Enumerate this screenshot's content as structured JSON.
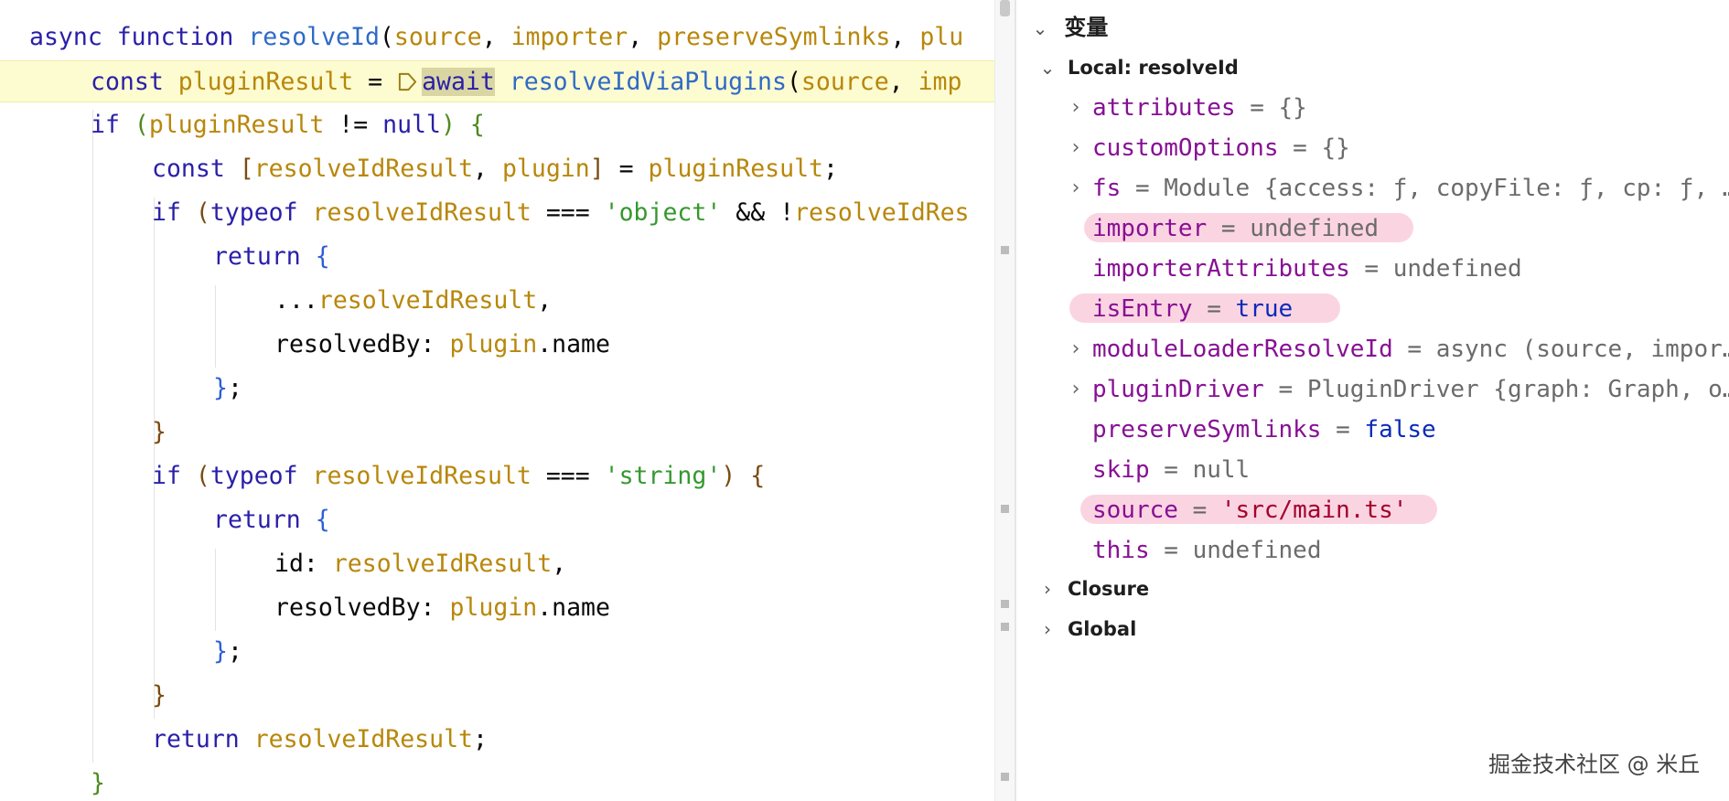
{
  "editor": {
    "lines": [
      {
        "indent": 0,
        "tokens": [
          {
            "t": "async function ",
            "c": "t-kw"
          },
          {
            "t": "resolveId",
            "c": "t-fn"
          },
          {
            "t": "(",
            "c": "t-plain"
          },
          {
            "t": "source",
            "c": "t-param"
          },
          {
            "t": ", ",
            "c": "t-plain"
          },
          {
            "t": "importer",
            "c": "t-param"
          },
          {
            "t": ", ",
            "c": "t-plain"
          },
          {
            "t": "preserveSymlinks",
            "c": "t-param"
          },
          {
            "t": ", ",
            "c": "t-plain"
          },
          {
            "t": "plu",
            "c": "t-param"
          }
        ]
      },
      {
        "indent": 1,
        "current": true,
        "breakpoint": true,
        "tokens": [
          {
            "t": "const ",
            "c": "t-kw"
          },
          {
            "t": "pluginResult",
            "c": "t-param"
          },
          {
            "t": " = ",
            "c": "t-plain"
          },
          {
            "t": "BP",
            "c": "bp"
          },
          {
            "t": "await",
            "c": "t-kw await-hl"
          },
          {
            "t": " ",
            "c": "t-plain"
          },
          {
            "t": "resolveIdViaPlugins",
            "c": "t-fn"
          },
          {
            "t": "(",
            "c": "t-plain"
          },
          {
            "t": "source",
            "c": "t-param"
          },
          {
            "t": ", ",
            "c": "t-plain"
          },
          {
            "t": "imp",
            "c": "t-param"
          }
        ]
      },
      {
        "indent": 1,
        "tokens": [
          {
            "t": "if ",
            "c": "t-kw"
          },
          {
            "t": "(",
            "c": "t-b1"
          },
          {
            "t": "pluginResult",
            "c": "t-param"
          },
          {
            "t": " != ",
            "c": "t-plain"
          },
          {
            "t": "null",
            "c": "t-null"
          },
          {
            "t": ")",
            "c": "t-b1"
          },
          {
            "t": " ",
            "c": "t-plain"
          },
          {
            "t": "{",
            "c": "t-b1"
          }
        ]
      },
      {
        "indent": 2,
        "tokens": [
          {
            "t": "const ",
            "c": "t-kw"
          },
          {
            "t": "[",
            "c": "t-b3"
          },
          {
            "t": "resolveIdResult",
            "c": "t-param"
          },
          {
            "t": ", ",
            "c": "t-plain"
          },
          {
            "t": "plugin",
            "c": "t-param"
          },
          {
            "t": "]",
            "c": "t-b3"
          },
          {
            "t": " = ",
            "c": "t-plain"
          },
          {
            "t": "pluginResult",
            "c": "t-param"
          },
          {
            "t": ";",
            "c": "t-plain"
          }
        ]
      },
      {
        "indent": 2,
        "tokens": [
          {
            "t": "if ",
            "c": "t-kw"
          },
          {
            "t": "(",
            "c": "t-b3"
          },
          {
            "t": "typeof ",
            "c": "t-kw"
          },
          {
            "t": "resolveIdResult",
            "c": "t-param"
          },
          {
            "t": " === ",
            "c": "t-plain"
          },
          {
            "t": "'object'",
            "c": "t-str"
          },
          {
            "t": " && !",
            "c": "t-plain"
          },
          {
            "t": "resolveIdRes",
            "c": "t-param"
          }
        ]
      },
      {
        "indent": 3,
        "tokens": [
          {
            "t": "return ",
            "c": "t-kw"
          },
          {
            "t": "{",
            "c": "t-b2"
          }
        ]
      },
      {
        "indent": 4,
        "tokens": [
          {
            "t": "...",
            "c": "t-plain"
          },
          {
            "t": "resolveIdResult",
            "c": "t-param"
          },
          {
            "t": ",",
            "c": "t-plain"
          }
        ]
      },
      {
        "indent": 4,
        "tokens": [
          {
            "t": "resolvedBy: ",
            "c": "t-plain"
          },
          {
            "t": "plugin",
            "c": "t-param"
          },
          {
            "t": ".name",
            "c": "t-plain"
          }
        ]
      },
      {
        "indent": 3,
        "tokens": [
          {
            "t": "}",
            "c": "t-b2"
          },
          {
            "t": ";",
            "c": "t-plain"
          }
        ]
      },
      {
        "indent": 2,
        "tokens": [
          {
            "t": "}",
            "c": "t-b3"
          }
        ]
      },
      {
        "indent": 2,
        "tokens": [
          {
            "t": "if ",
            "c": "t-kw"
          },
          {
            "t": "(",
            "c": "t-b3"
          },
          {
            "t": "typeof ",
            "c": "t-kw"
          },
          {
            "t": "resolveIdResult",
            "c": "t-param"
          },
          {
            "t": " === ",
            "c": "t-plain"
          },
          {
            "t": "'string'",
            "c": "t-str"
          },
          {
            "t": ")",
            "c": "t-b3"
          },
          {
            "t": " ",
            "c": "t-plain"
          },
          {
            "t": "{",
            "c": "t-b3"
          }
        ]
      },
      {
        "indent": 3,
        "tokens": [
          {
            "t": "return ",
            "c": "t-kw"
          },
          {
            "t": "{",
            "c": "t-b2"
          }
        ]
      },
      {
        "indent": 4,
        "tokens": [
          {
            "t": "id: ",
            "c": "t-plain"
          },
          {
            "t": "resolveIdResult",
            "c": "t-param"
          },
          {
            "t": ",",
            "c": "t-plain"
          }
        ]
      },
      {
        "indent": 4,
        "tokens": [
          {
            "t": "resolvedBy: ",
            "c": "t-plain"
          },
          {
            "t": "plugin",
            "c": "t-param"
          },
          {
            "t": ".name",
            "c": "t-plain"
          }
        ]
      },
      {
        "indent": 3,
        "tokens": [
          {
            "t": "}",
            "c": "t-b2"
          },
          {
            "t": ";",
            "c": "t-plain"
          }
        ]
      },
      {
        "indent": 2,
        "tokens": [
          {
            "t": "}",
            "c": "t-b3"
          }
        ]
      },
      {
        "indent": 2,
        "tokens": [
          {
            "t": "return ",
            "c": "t-kw"
          },
          {
            "t": "resolveIdResult",
            "c": "t-param"
          },
          {
            "t": ";",
            "c": "t-plain"
          }
        ]
      },
      {
        "indent": 1,
        "tokens": [
          {
            "t": "}",
            "c": "t-b1"
          }
        ]
      }
    ]
  },
  "variables": {
    "header": "变量",
    "frame_label": "Local: resolveId",
    "items": [
      {
        "name": "attributes",
        "value": "{}",
        "style": "v-gray",
        "expandable": true,
        "highlight": false
      },
      {
        "name": "customOptions",
        "value": "{}",
        "style": "v-gray",
        "expandable": true,
        "highlight": false
      },
      {
        "name": "fs",
        "value": "Module {access: ƒ, copyFile: ƒ, cp: ƒ, …",
        "style": "v-gray",
        "expandable": true,
        "highlight": false
      },
      {
        "name": "importer",
        "value": "undefined",
        "style": "v-gray",
        "expandable": false,
        "highlight": true
      },
      {
        "name": "importerAttributes",
        "value": "undefined",
        "style": "v-gray",
        "expandable": false,
        "highlight": false
      },
      {
        "name": "isEntry",
        "value": "true",
        "style": "v-kw",
        "expandable": false,
        "highlight": true
      },
      {
        "name": "moduleLoaderResolveId",
        "value": "async (source, impor…",
        "style": "v-gray",
        "expandable": true,
        "highlight": false
      },
      {
        "name": "pluginDriver",
        "value": "PluginDriver {graph: Graph, o…",
        "style": "v-gray",
        "expandable": true,
        "highlight": false
      },
      {
        "name": "preserveSymlinks",
        "value": "false",
        "style": "v-kw",
        "expandable": false,
        "highlight": false
      },
      {
        "name": "skip",
        "value": "null",
        "style": "v-gray",
        "expandable": false,
        "highlight": false
      },
      {
        "name": "source",
        "value": "'src/main.ts'",
        "style": "v-str",
        "expandable": false,
        "highlight": true
      },
      {
        "name": "this",
        "value": "undefined",
        "style": "v-gray",
        "expandable": false,
        "highlight": false
      }
    ],
    "groups": [
      "Closure",
      "Global"
    ]
  },
  "watermark": "掘金技术社区 @ 米丘",
  "colors": {
    "current_line": "#fdfbd0",
    "highlight_pink": "#fbd2e0",
    "var_name": "#871094",
    "keyword": "#2a1fa8",
    "function": "#2f6ac6",
    "param": "#b8870b",
    "string": "#35982f"
  },
  "icons": {
    "breakpoint": "execution-point-icon",
    "expand": "chevron-right-icon",
    "collapse": "chevron-down-icon"
  }
}
